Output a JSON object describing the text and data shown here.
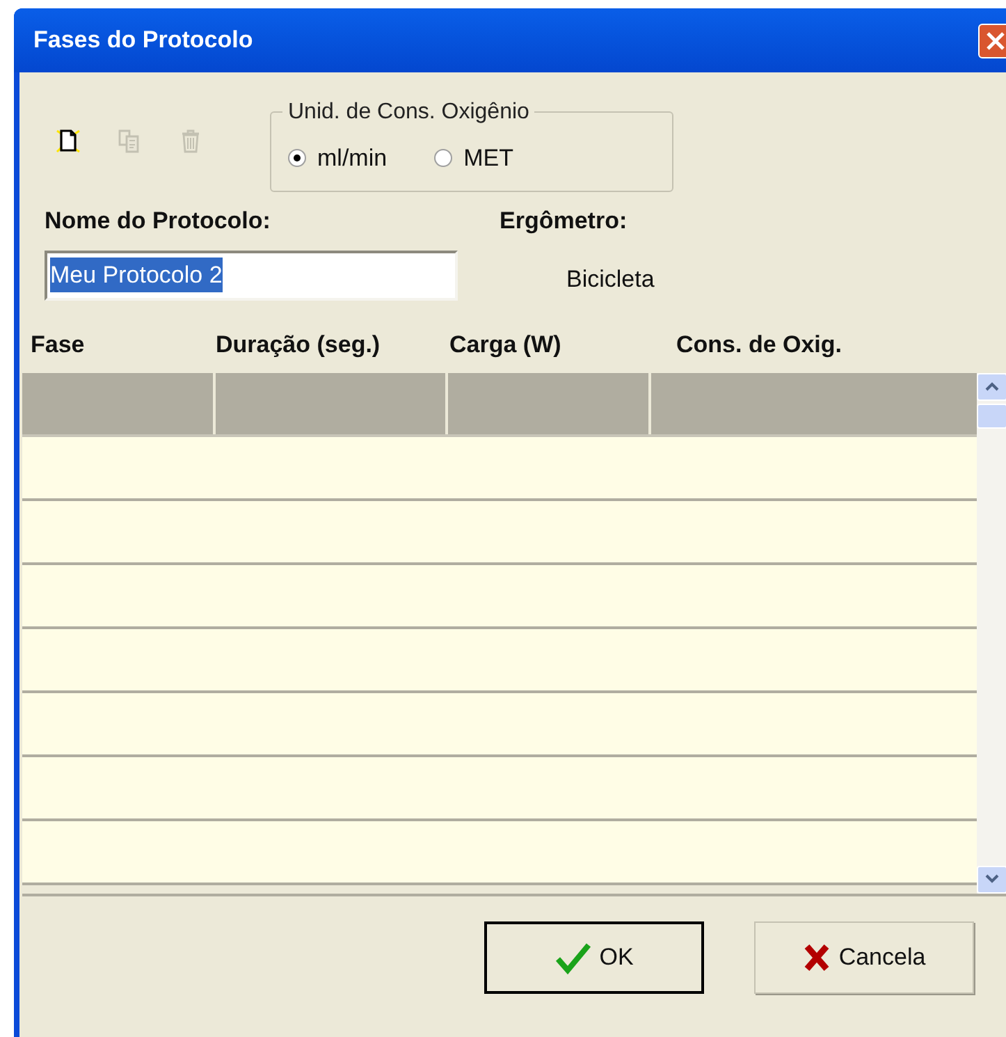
{
  "window": {
    "title": "Fases do Protocolo"
  },
  "toolbar": [
    {
      "kind": "new",
      "disabled": false
    },
    {
      "kind": "copy",
      "disabled": true
    },
    {
      "kind": "delete",
      "disabled": true
    }
  ],
  "oxygen_units": {
    "legend": "Unid. de Cons. Oxigênio",
    "options": [
      {
        "label": "ml/min",
        "selected": true
      },
      {
        "label": "MET",
        "selected": false
      }
    ]
  },
  "protocol_name": {
    "label": "Nome do Protocolo:",
    "value": "Meu Protocolo 2"
  },
  "ergometer": {
    "label": "Ergômetro:",
    "value": "Bicicleta"
  },
  "table": {
    "columns": [
      "Fase",
      "Duração (seg.)",
      "Carga (W)",
      "Cons. de Oxig."
    ],
    "rows": [
      {
        "selected": true
      },
      {
        "selected": false
      },
      {
        "selected": false
      },
      {
        "selected": false
      },
      {
        "selected": false
      },
      {
        "selected": false
      },
      {
        "selected": false
      },
      {
        "selected": false
      }
    ]
  },
  "buttons": [
    {
      "kind": "ok",
      "label": "OK"
    },
    {
      "kind": "cancel",
      "label": "Cancela"
    }
  ]
}
